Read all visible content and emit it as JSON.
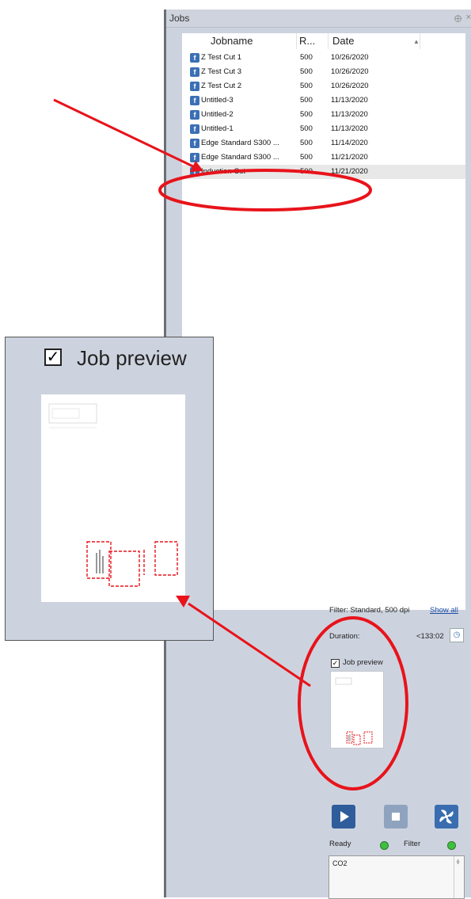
{
  "window": {
    "title": "Jobs",
    "pin_glyph": "⨁",
    "close_glyph": "×"
  },
  "columns": {
    "name": "Jobname",
    "resolution": "R...",
    "date": "Date",
    "sort_glyph": "▲"
  },
  "jobs": [
    {
      "name": "Z Test Cut 1",
      "resolution": "500",
      "date": "10/26/2020"
    },
    {
      "name": "Z Test Cut 3",
      "resolution": "500",
      "date": "10/26/2020"
    },
    {
      "name": "Z Test Cut 2",
      "resolution": "500",
      "date": "10/26/2020"
    },
    {
      "name": "Untitled-3",
      "resolution": "500",
      "date": "11/13/2020"
    },
    {
      "name": "Untitled-2",
      "resolution": "500",
      "date": "11/13/2020"
    },
    {
      "name": "Untitled-1",
      "resolution": "500",
      "date": "11/13/2020"
    },
    {
      "name": "Edge Standard S300 ...",
      "resolution": "500",
      "date": "11/14/2020"
    },
    {
      "name": "Edge Standard S300 ...",
      "resolution": "500",
      "date": "11/21/2020"
    },
    {
      "name": "Induction Cut",
      "resolution": "500",
      "date": "11/21/2020"
    }
  ],
  "filter": {
    "label": "Filter: Standard, 500 dpi",
    "show_all": "Show all"
  },
  "duration": {
    "label": "Duration:",
    "value": "<133:02"
  },
  "preview": {
    "label": "Job preview",
    "zoom_label": "Job preview",
    "checked": true
  },
  "status": {
    "ready_label": "Ready",
    "filter_label": "Filter",
    "led_color": "#3fbf3f"
  },
  "laser": {
    "text": "CO2"
  },
  "icons": {
    "job": "job-file-icon",
    "play": "play-icon",
    "stop": "stop-icon",
    "fan": "fan-icon",
    "timer": "timer-icon"
  },
  "annotation_color": "#e8131b"
}
